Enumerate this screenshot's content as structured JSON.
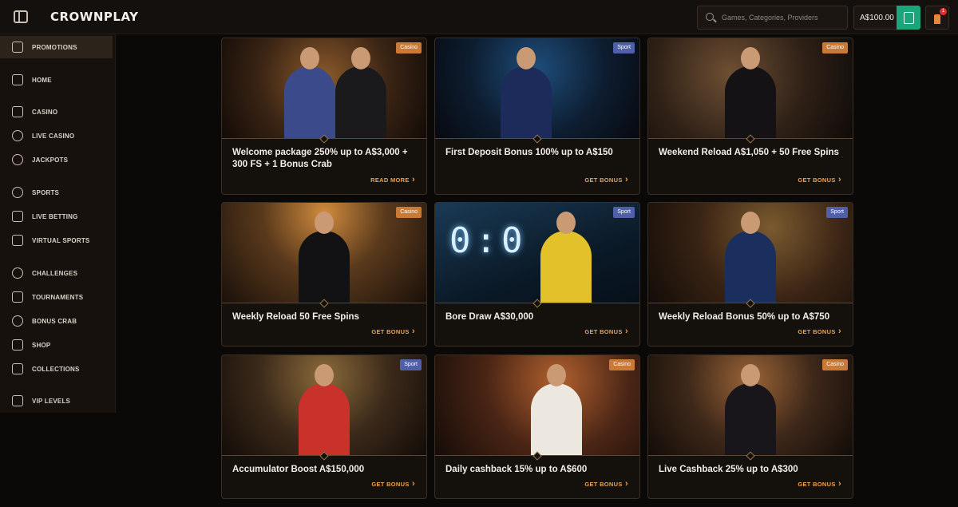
{
  "header": {
    "logo_text": "CROWNPLAY",
    "search_placeholder": "Games, Categories, Providers",
    "balance": "A$100.00",
    "notification_count": "1"
  },
  "sidebar": {
    "items": [
      {
        "label": "PROMOTIONS",
        "icon": "gift-icon",
        "active": true
      },
      {
        "label": "HOME",
        "icon": "home-icon"
      },
      {
        "label": "CASINO",
        "icon": "slot-machine-icon"
      },
      {
        "label": "LIVE CASINO",
        "icon": "spade-icon"
      },
      {
        "label": "JACKPOTS",
        "icon": "jackpot-icon"
      },
      {
        "label": "SPORTS",
        "icon": "ball-icon"
      },
      {
        "label": "LIVE BETTING",
        "icon": "live-betting-icon"
      },
      {
        "label": "VIRTUAL SPORTS",
        "icon": "gamepad-icon"
      },
      {
        "label": "CHALLENGES",
        "icon": "medal-icon"
      },
      {
        "label": "TOURNAMENTS",
        "icon": "trophy-icon"
      },
      {
        "label": "BONUS CRAB",
        "icon": "crab-icon"
      },
      {
        "label": "SHOP",
        "icon": "shop-icon"
      },
      {
        "label": "COLLECTIONS",
        "icon": "collections-icon"
      },
      {
        "label": "VIP LEVELS",
        "icon": "crown-icon"
      }
    ]
  },
  "promotions": [
    {
      "title": "Welcome package 250% up to A$3,000 + 300 FS + 1 Bonus Crab",
      "badge": "Casino",
      "action": "READ MORE"
    },
    {
      "title": "First Deposit Bonus 100% up to A$150",
      "badge": "Sport",
      "action": "GET BONUS"
    },
    {
      "title": "Weekend Reload A$1,050 + 50 Free Spins",
      "badge": "Casino",
      "action": "GET BONUS"
    },
    {
      "title": "Weekly Reload 50 Free Spins",
      "badge": "Casino",
      "action": "GET BONUS"
    },
    {
      "title": "Bore Draw A$30,000",
      "badge": "Sport",
      "action": "GET BONUS"
    },
    {
      "title": "Weekly Reload Bonus 50% up to A$750",
      "badge": "Sport",
      "action": "GET BONUS"
    },
    {
      "title": "Accumulator Boost A$150,000",
      "badge": "Sport",
      "action": "GET BONUS"
    },
    {
      "title": "Daily cashback 15% up to A$600",
      "badge": "Casino",
      "action": "GET BONUS"
    },
    {
      "title": "Live Cashback 25% up to A$300",
      "badge": "Casino",
      "action": "GET BONUS"
    }
  ],
  "scoreboard_text": "0:0",
  "colors": {
    "accent": "#e9a24f",
    "deposit": "#1aa67a",
    "casino_badge": "#c97a37",
    "sport_badge": "#4f5fa8"
  }
}
